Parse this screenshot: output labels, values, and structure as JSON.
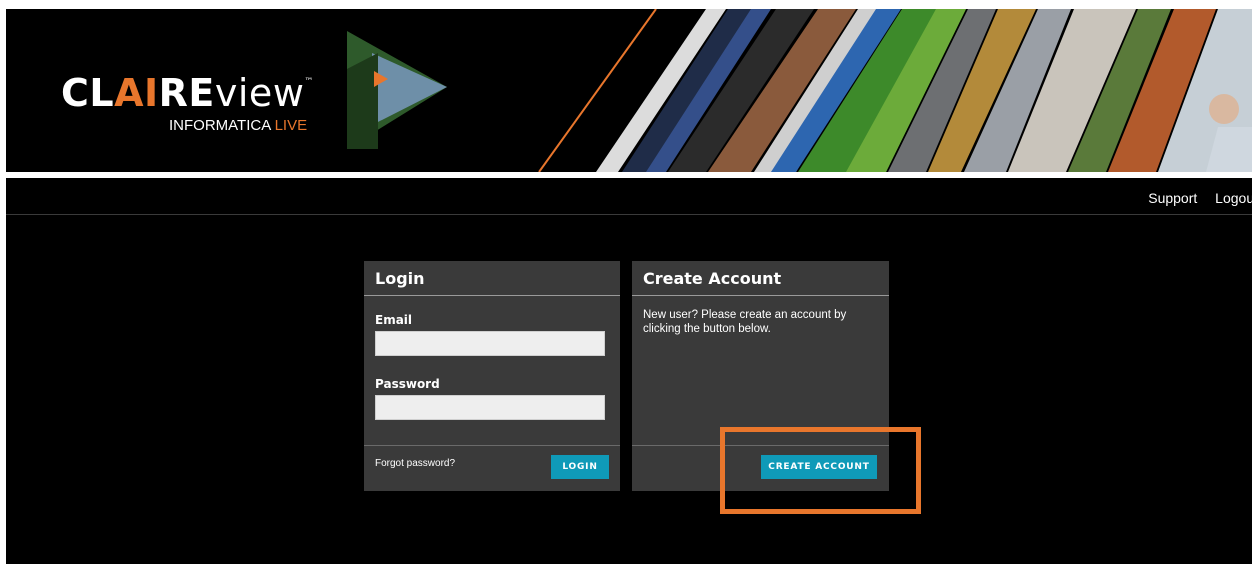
{
  "banner": {
    "brand_prefix": "CL",
    "brand_accent": "AI",
    "brand_mid": "RE",
    "brand_suffix": "view",
    "trademark": "™",
    "sub_main": "INFORMATICA ",
    "sub_accent": "LIVE"
  },
  "nav": {
    "support": "Support",
    "logout": "Logout"
  },
  "login": {
    "title": "Login",
    "email_label": "Email",
    "email_value": "",
    "password_label": "Password",
    "password_value": "",
    "forgot": "Forgot password?",
    "button": "LOGIN"
  },
  "create": {
    "title": "Create Account",
    "text": "New user? Please create an account by clicking the button below.",
    "button": "CREATE ACCOUNT"
  },
  "colors": {
    "accent_orange": "#e8762c",
    "button_teal": "#0f9ab8",
    "panel_bg": "#3a3a3a"
  }
}
